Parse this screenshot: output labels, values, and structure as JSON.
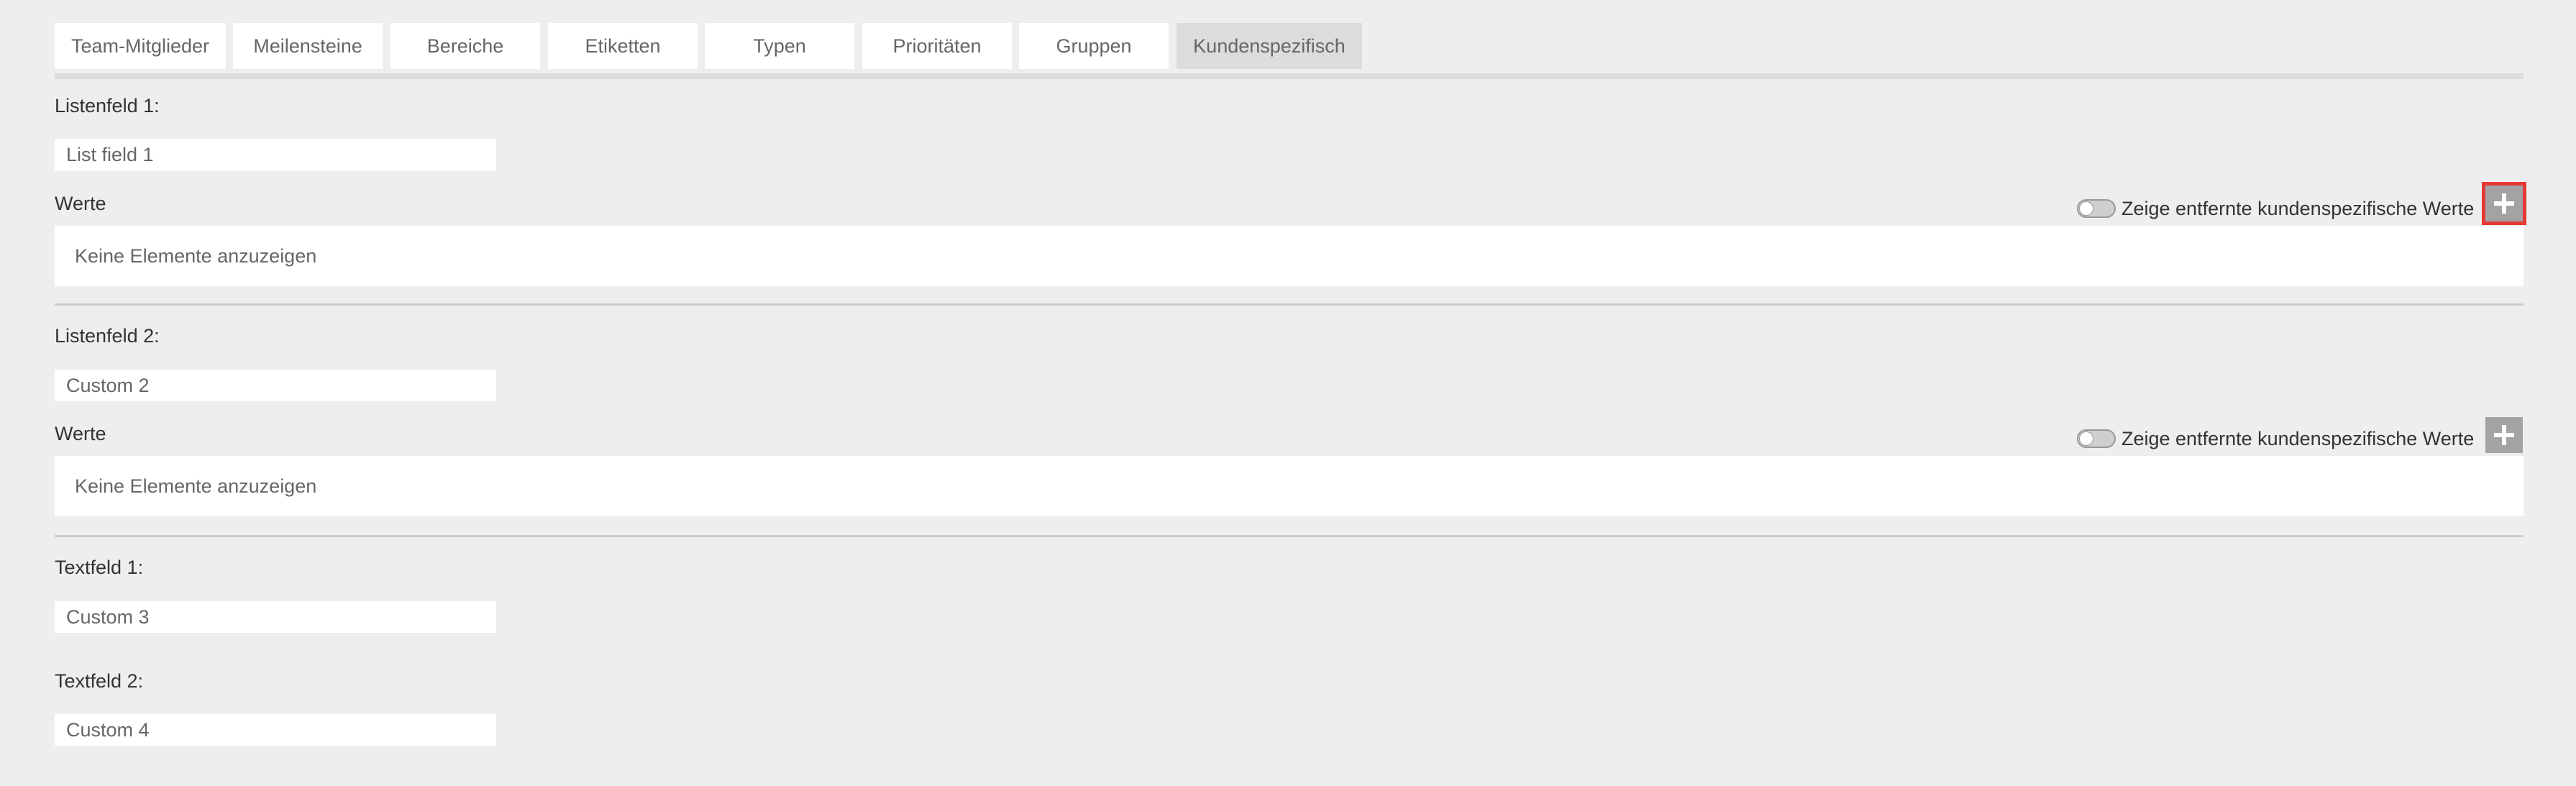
{
  "tabs": [
    {
      "label": "Team-Mitglieder"
    },
    {
      "label": "Meilensteine"
    },
    {
      "label": "Bereiche"
    },
    {
      "label": "Etiketten"
    },
    {
      "label": "Typen"
    },
    {
      "label": "Prioritäten"
    },
    {
      "label": "Gruppen"
    },
    {
      "label": "Kundenspezifisch",
      "active": true
    }
  ],
  "sections": {
    "list1": {
      "label": "Listenfeld 1:",
      "value": "List field 1",
      "values_label": "Werte",
      "toggle_label": "Zeige entfernte kundenspezifische Werte",
      "empty_text": "Keine Elemente anzuzeigen",
      "add_icon": "plus-icon"
    },
    "list2": {
      "label": "Listenfeld 2:",
      "value": "Custom 2",
      "values_label": "Werte",
      "toggle_label": "Zeige entfernte kundenspezifische Werte",
      "empty_text": "Keine Elemente anzuzeigen",
      "add_icon": "plus-icon"
    },
    "text1": {
      "label": "Textfeld 1:",
      "value": "Custom 3"
    },
    "text2": {
      "label": "Textfeld 2:",
      "value": "Custom 4"
    }
  },
  "colors": {
    "background": "#eeeeee",
    "button": "#a3a3a3",
    "highlight": "#e53935"
  }
}
